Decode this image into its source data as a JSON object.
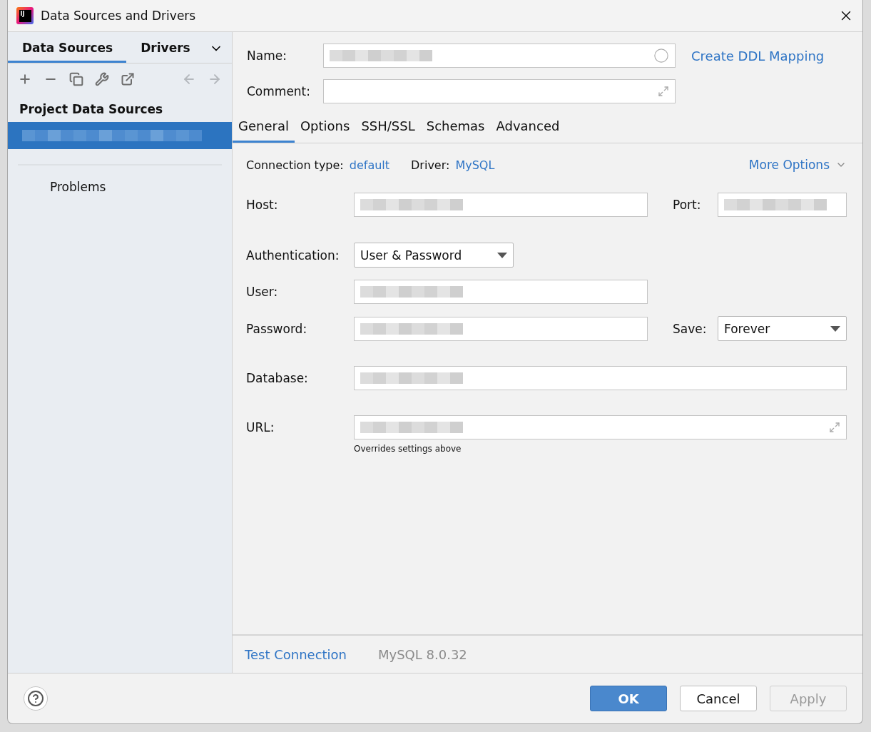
{
  "window": {
    "logo": "IJ",
    "title": "Data Sources and Drivers"
  },
  "left_tabs": [
    {
      "label": "Data Sources",
      "selected": true
    },
    {
      "label": "Drivers",
      "selected": false
    }
  ],
  "toolbar": [
    {
      "kind": "add",
      "disabled": false
    },
    {
      "kind": "remove",
      "disabled": false
    },
    {
      "kind": "copy",
      "disabled": false
    },
    {
      "kind": "wrench",
      "disabled": false
    },
    {
      "kind": "export",
      "disabled": false
    },
    {
      "kind": "back",
      "disabled": true
    },
    {
      "kind": "forward",
      "disabled": true
    }
  ],
  "sidebar": {
    "heading": "Project Data Sources",
    "items": [
      {
        "redacted": true,
        "selected": true
      }
    ],
    "problems": "Problems"
  },
  "name": {
    "label": "Name:",
    "redacted": true
  },
  "comment": {
    "label": "Comment:"
  },
  "ddl_link": "Create DDL Mapping",
  "tabs": [
    {
      "label": "General",
      "selected": true
    },
    {
      "label": "Options",
      "selected": false
    },
    {
      "label": "SSH/SSL",
      "selected": false
    },
    {
      "label": "Schemas",
      "selected": false
    },
    {
      "label": "Advanced",
      "selected": false
    }
  ],
  "connection_type": {
    "label": "Connection type:",
    "value": "default"
  },
  "driver": {
    "label": "Driver:",
    "value": "MySQL"
  },
  "more_options": "More Options",
  "form": {
    "host": {
      "label": "Host:",
      "redacted": true
    },
    "port": {
      "label": "Port:",
      "redacted": true
    },
    "authentication": {
      "label": "Authentication:",
      "value": "User & Password"
    },
    "user": {
      "label": "User:",
      "redacted": true
    },
    "password": {
      "label": "Password:",
      "redacted": true
    },
    "save": {
      "label": "Save:",
      "value": "Forever"
    },
    "database": {
      "label": "Database:",
      "redacted": true
    },
    "url": {
      "label": "URL:",
      "redacted": true,
      "hint": "Overrides settings above"
    }
  },
  "test_connection": "Test Connection",
  "driver_version": "MySQL 8.0.32",
  "buttons": [
    {
      "label": "OK",
      "kind": "primary",
      "disabled": false
    },
    {
      "label": "Cancel",
      "kind": "normal",
      "disabled": false
    },
    {
      "label": "Apply",
      "kind": "normal",
      "disabled": true
    }
  ]
}
